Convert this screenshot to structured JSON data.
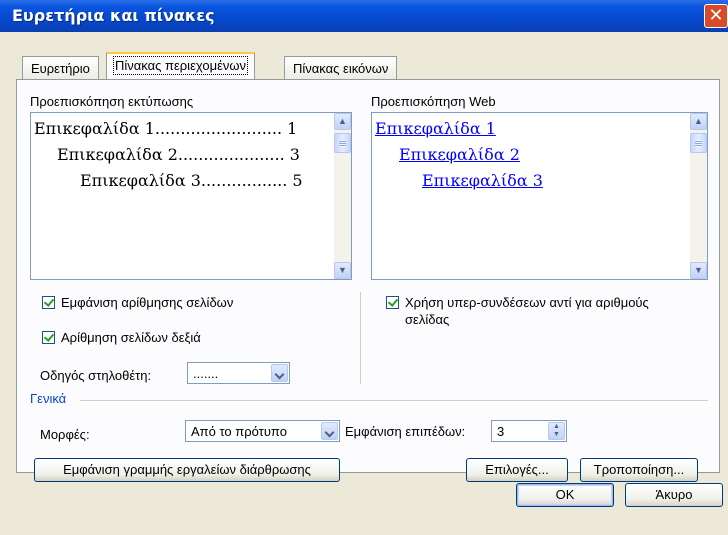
{
  "window": {
    "title": "Ευρετήρια και πίνακες",
    "close_glyph": "✕"
  },
  "tabs": [
    {
      "label": "Ευρετήριο",
      "active": false
    },
    {
      "label": "Πίνακας περιεχομένων",
      "active": true
    },
    {
      "label": "Πίνακας εικόνων",
      "active": false
    }
  ],
  "print_preview": {
    "label": "Προεπισκόπηση εκτύπωσης",
    "lines": [
      "Επικεφαλίδα 1......................... 1",
      "Επικεφαλίδα 2..................... 3",
      "Επικεφαλίδα 3................. 5"
    ]
  },
  "web_preview": {
    "label": "Προεπισκόπηση Web",
    "links": [
      "Επικεφαλίδα 1",
      "Επικεφαλίδα 2",
      "Επικεφαλίδα 3"
    ],
    "link_color": "#0000ff"
  },
  "options": {
    "show_page_numbers": "Εμφάνιση αρίθμησης σελίδων",
    "right_align_page_numbers": "Αρίθμηση σελίδων δεξιά",
    "use_hyperlinks_line1": "Χρήση υπερ-συνδέσεων αντί για αριθμούς",
    "use_hyperlinks_line2": "σελίδας",
    "tab_leader_label": "Οδηγός στηλοθέτη:",
    "tab_leader_value": "......."
  },
  "general": {
    "legend": "Γενικά",
    "formats_label": "Μορφές:",
    "formats_value": "Από το πρότυπο",
    "show_levels_label": "Εμφάνιση επιπέδων:",
    "show_levels_value": "3"
  },
  "buttons": {
    "outlining_toolbar": "Εμφάνιση γραμμής εργαλείων διάρθρωσης",
    "options": "Επιλογές...",
    "modify": "Τροποποίηση...",
    "ok": "OK",
    "cancel": "Άκυρο"
  },
  "colors": {
    "titlebar": "#0646c8",
    "dialog_bg": "#ece9d8",
    "group_legend": "#0046d5"
  }
}
